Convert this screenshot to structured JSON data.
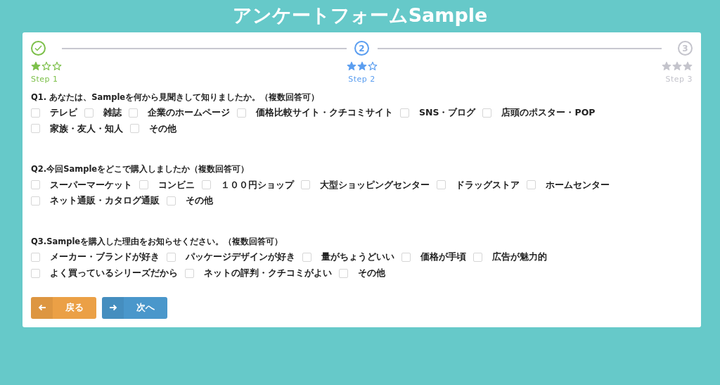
{
  "title": "アンケートフォームSample",
  "steps": [
    {
      "kind": "done",
      "label": "Step 1",
      "stars": 1
    },
    {
      "kind": "current",
      "number": "2",
      "label": "Step 2",
      "stars": 2
    },
    {
      "kind": "todo",
      "number": "3",
      "label": "Step 3",
      "stars": 0
    }
  ],
  "questions": [
    {
      "text": "Q1. あなたは、Sampleを何から見聞きして知りましたか。（複数回答可）",
      "options": [
        {
          "label": "テレビ",
          "checked": false
        },
        {
          "label": "雑誌",
          "checked": false
        },
        {
          "label": "企業のホームページ",
          "checked": false
        },
        {
          "label": "価格比較サイト・クチコミサイト",
          "checked": false
        },
        {
          "label": "SNS・ブログ",
          "checked": false
        },
        {
          "label": "店頭のポスター・POP",
          "checked": false
        },
        {
          "label": "家族・友人・知人",
          "checked": false
        },
        {
          "label": "その他",
          "checked": false
        }
      ]
    },
    {
      "text": "Q2.今回Sampleをどこで購入しましたか（複数回答可）",
      "options": [
        {
          "label": "スーパーマーケット",
          "checked": false
        },
        {
          "label": "コンビニ",
          "checked": false
        },
        {
          "label": "１００円ショップ",
          "checked": false
        },
        {
          "label": "大型ショッピングセンター",
          "checked": false
        },
        {
          "label": "ドラッグストア",
          "checked": false
        },
        {
          "label": "ホームセンター",
          "checked": false
        },
        {
          "label": "ネット通販・カタログ通販",
          "checked": false
        },
        {
          "label": "その他",
          "checked": false
        }
      ]
    },
    {
      "text": "Q3.Sampleを購入した理由をお知らせください。（複数回答可）",
      "options": [
        {
          "label": "メーカー・ブランドが好き",
          "checked": false
        },
        {
          "label": "パッケージデザインが好き",
          "checked": false
        },
        {
          "label": "量がちょうどいい",
          "checked": false
        },
        {
          "label": "価格が手頃",
          "checked": false
        },
        {
          "label": "広告が魅力的",
          "checked": false
        },
        {
          "label": "よく買っているシリーズだから",
          "checked": false
        },
        {
          "label": "ネットの評判・クチコミがよい",
          "checked": false
        },
        {
          "label": "その他",
          "checked": false
        }
      ]
    }
  ],
  "buttons": [
    {
      "kind": "back",
      "label": "戻る"
    },
    {
      "kind": "next",
      "label": "次へ"
    }
  ]
}
